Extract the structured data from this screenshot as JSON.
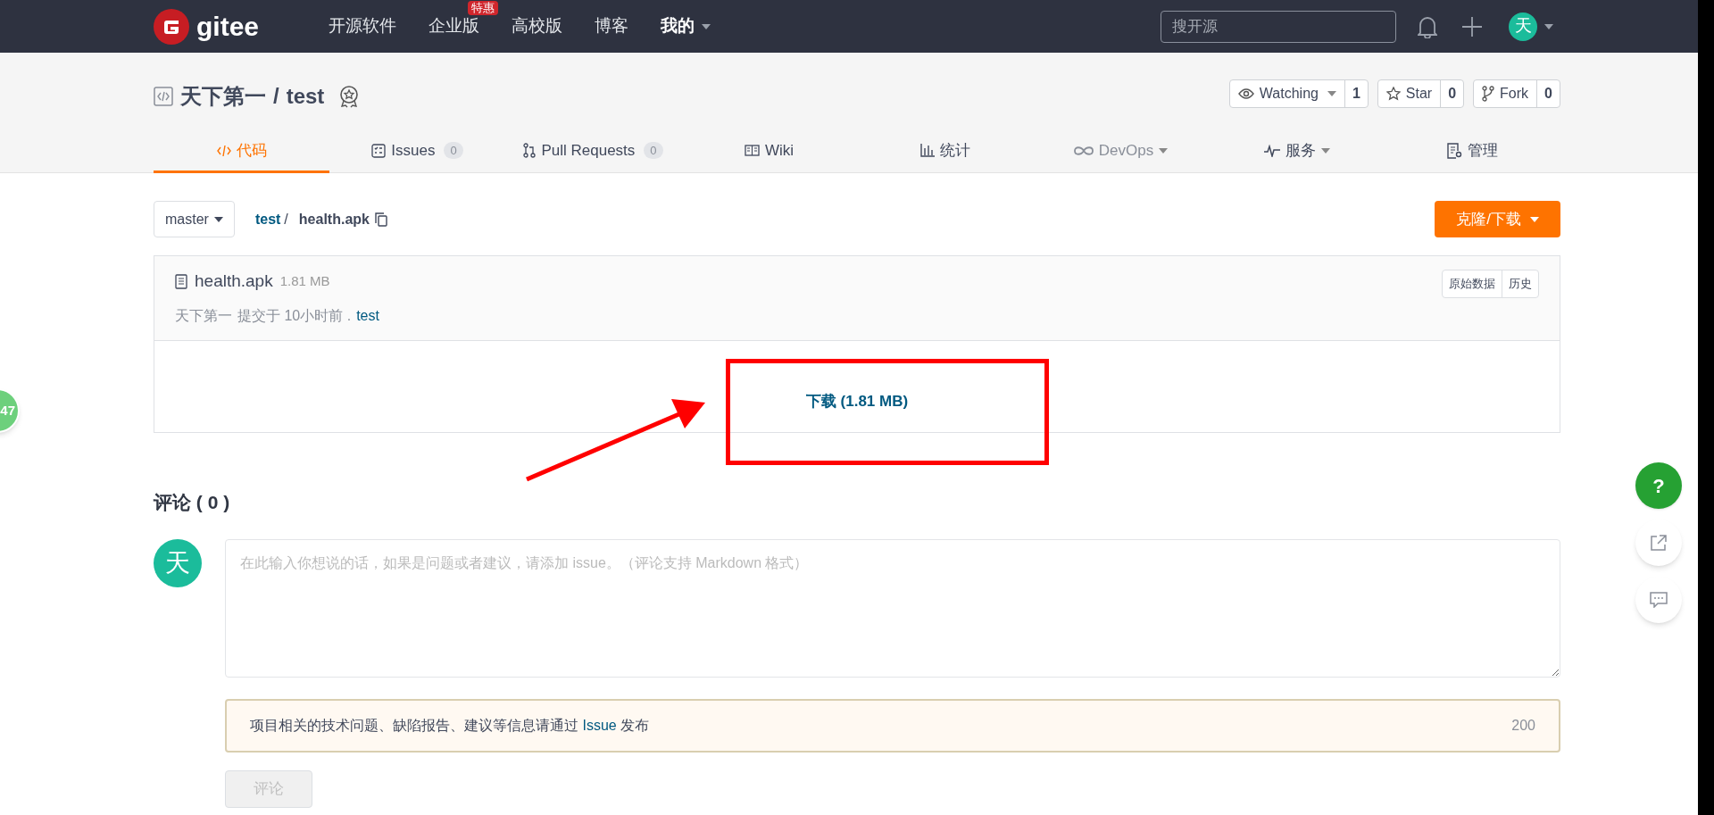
{
  "navbar": {
    "logo": "gitee",
    "items": [
      {
        "label": "开源软件",
        "dropdown": false
      },
      {
        "label": "企业版",
        "badge": "特惠",
        "dropdown": false
      },
      {
        "label": "高校版",
        "dropdown": false
      },
      {
        "label": "博客",
        "dropdown": false
      },
      {
        "label": "我的",
        "dropdown": true
      }
    ],
    "search": {
      "placeholder": "搜开源"
    },
    "avatar": "天"
  },
  "repo": {
    "owner": "天下第一",
    "separator": "/",
    "name": "test",
    "actions": [
      {
        "label": "Watching",
        "count": "1",
        "kind": "watch"
      },
      {
        "label": "Star",
        "count": "0",
        "kind": "star"
      },
      {
        "label": "Fork",
        "count": "0",
        "kind": "fork"
      }
    ]
  },
  "tabs": [
    {
      "label": "代码",
      "kind": "code",
      "selected": true,
      "dropdown": false,
      "disabled": false
    },
    {
      "label": "Issues",
      "count": "0",
      "kind": "issues",
      "selected": false,
      "dropdown": false,
      "disabled": false
    },
    {
      "label": "Pull Requests",
      "count": "0",
      "kind": "pr",
      "selected": false,
      "dropdown": false,
      "disabled": false
    },
    {
      "label": "Wiki",
      "kind": "wiki",
      "selected": false,
      "dropdown": false,
      "disabled": false
    },
    {
      "label": "统计",
      "kind": "stats",
      "selected": false,
      "dropdown": false,
      "disabled": false
    },
    {
      "label": "DevOps",
      "kind": "devops",
      "selected": false,
      "dropdown": true,
      "disabled": true
    },
    {
      "label": "服务",
      "kind": "service",
      "selected": false,
      "dropdown": true,
      "disabled": false
    },
    {
      "label": "管理",
      "kind": "manage",
      "selected": false,
      "dropdown": false,
      "disabled": false
    }
  ],
  "branch": "master",
  "breadcrumb": {
    "repo": "test",
    "separator": "/",
    "file": "health.apk"
  },
  "clone_button": "克隆/下载",
  "file": {
    "name": "health.apk",
    "size": "1.81 MB",
    "author": "天下第一",
    "commit_text": "提交于 10小时前 .",
    "commit_link": "test",
    "buttons": [
      "原始数据",
      "历史"
    ],
    "download": "下载 (1.81 MB)"
  },
  "comments": {
    "title": "评论 ( 0 )",
    "avatar": "天",
    "placeholder": "在此输入你想说的话，如果是问题或者建议，请添加 issue。（评论支持 Markdown 格式）",
    "notice_text": "项目相关的技术问题、缺陷报告、建议等信息请通过",
    "notice_link": "Issue",
    "notice_end": "发布",
    "char_limit": "200",
    "submit": "评论"
  },
  "side_badge": "47",
  "float_buttons": [
    {
      "kind": "help",
      "label": "?"
    },
    {
      "kind": "share"
    },
    {
      "kind": "chat"
    }
  ]
}
